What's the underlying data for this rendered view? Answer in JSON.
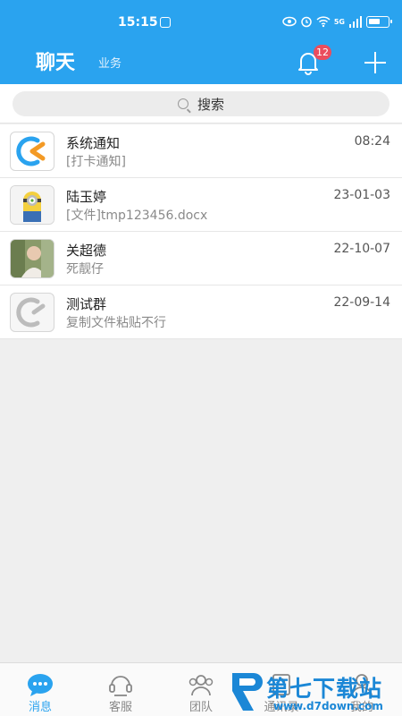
{
  "status_bar": {
    "time": "15:15",
    "network": "5G"
  },
  "header": {
    "title": "聊天",
    "subtitle": "业务",
    "notification_count": "12"
  },
  "search": {
    "placeholder": "搜索"
  },
  "conversations": [
    {
      "name": "系统通知",
      "message": "[打卡通知]",
      "time": "08:24",
      "avatar": "app-logo"
    },
    {
      "name": "陆玉婷",
      "message": "[文件]tmp123456.docx",
      "time": "23-01-03",
      "avatar": "minion-photo"
    },
    {
      "name": "关超德",
      "message": "死靓仔",
      "time": "22-10-07",
      "avatar": "person-photo"
    },
    {
      "name": "测试群",
      "message": "复制文件粘贴不行",
      "time": "22-09-14",
      "avatar": "group-logo"
    }
  ],
  "tabs": [
    {
      "label": "消息",
      "active": true
    },
    {
      "label": "客服"
    },
    {
      "label": "团队"
    },
    {
      "label": "通讯录"
    },
    {
      "label": "我的"
    }
  ],
  "watermark": {
    "text": "第七下载站",
    "url": "www.d7down.com"
  },
  "colors": {
    "primary": "#2aa3ef",
    "badge": "#ea4d5d",
    "logo_orange": "#f39a25"
  }
}
